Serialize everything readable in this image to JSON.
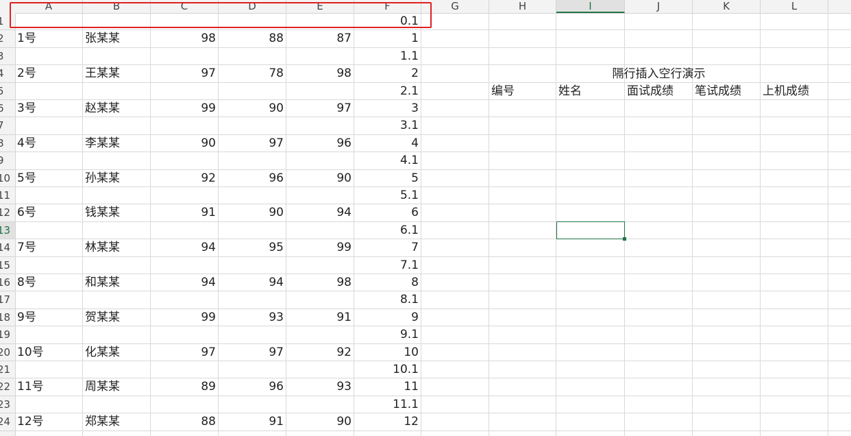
{
  "columns": [
    "A",
    "B",
    "C",
    "D",
    "E",
    "F",
    "G",
    "H",
    "I",
    "J",
    "K",
    "L"
  ],
  "selected_column": "I",
  "selected_row": 13,
  "rows": [
    {
      "num": "1",
      "A": "",
      "B": "",
      "C": "",
      "D": "",
      "E": "",
      "F": "0.1"
    },
    {
      "num": "2",
      "A": "1号",
      "B": "张某某",
      "C": "98",
      "D": "88",
      "E": "87",
      "F": "1"
    },
    {
      "num": "3",
      "A": "",
      "B": "",
      "C": "",
      "D": "",
      "E": "",
      "F": "1.1"
    },
    {
      "num": "4",
      "A": "2号",
      "B": "王某某",
      "C": "97",
      "D": "78",
      "E": "98",
      "F": "2"
    },
    {
      "num": "5",
      "A": "",
      "B": "",
      "C": "",
      "D": "",
      "E": "",
      "F": "2.1"
    },
    {
      "num": "6",
      "A": "3号",
      "B": "赵某某",
      "C": "99",
      "D": "90",
      "E": "97",
      "F": "3"
    },
    {
      "num": "7",
      "A": "",
      "B": "",
      "C": "",
      "D": "",
      "E": "",
      "F": "3.1"
    },
    {
      "num": "8",
      "A": "4号",
      "B": "李某某",
      "C": "90",
      "D": "97",
      "E": "96",
      "F": "4"
    },
    {
      "num": "9",
      "A": "",
      "B": "",
      "C": "",
      "D": "",
      "E": "",
      "F": "4.1"
    },
    {
      "num": "10",
      "A": "5号",
      "B": "孙某某",
      "C": "92",
      "D": "96",
      "E": "90",
      "F": "5"
    },
    {
      "num": "11",
      "A": "",
      "B": "",
      "C": "",
      "D": "",
      "E": "",
      "F": "5.1"
    },
    {
      "num": "12",
      "A": "6号",
      "B": "钱某某",
      "C": "91",
      "D": "90",
      "E": "94",
      "F": "6"
    },
    {
      "num": "13",
      "A": "",
      "B": "",
      "C": "",
      "D": "",
      "E": "",
      "F": "6.1"
    },
    {
      "num": "14",
      "A": "7号",
      "B": "林某某",
      "C": "94",
      "D": "95",
      "E": "99",
      "F": "7"
    },
    {
      "num": "15",
      "A": "",
      "B": "",
      "C": "",
      "D": "",
      "E": "",
      "F": "7.1"
    },
    {
      "num": "16",
      "A": "8号",
      "B": "和某某",
      "C": "94",
      "D": "94",
      "E": "98",
      "F": "8"
    },
    {
      "num": "17",
      "A": "",
      "B": "",
      "C": "",
      "D": "",
      "E": "",
      "F": "8.1"
    },
    {
      "num": "18",
      "A": "9号",
      "B": "贺某某",
      "C": "99",
      "D": "93",
      "E": "91",
      "F": "9"
    },
    {
      "num": "19",
      "A": "",
      "B": "",
      "C": "",
      "D": "",
      "E": "",
      "F": "9.1"
    },
    {
      "num": "20",
      "A": "10号",
      "B": "化某某",
      "C": "97",
      "D": "97",
      "E": "92",
      "F": "10"
    },
    {
      "num": "21",
      "A": "",
      "B": "",
      "C": "",
      "D": "",
      "E": "",
      "F": "10.1"
    },
    {
      "num": "22",
      "A": "11号",
      "B": "周某某",
      "C": "89",
      "D": "96",
      "E": "93",
      "F": "11"
    },
    {
      "num": "23",
      "A": "",
      "B": "",
      "C": "",
      "D": "",
      "E": "",
      "F": "11.1"
    },
    {
      "num": "24",
      "A": "12号",
      "B": "郑某某",
      "C": "88",
      "D": "91",
      "E": "90",
      "F": "12"
    }
  ],
  "demo": {
    "title": "隔行插入空行演示",
    "headers": [
      "编号",
      "姓名",
      "面试成绩",
      "笔试成绩",
      "上机成绩"
    ]
  },
  "colors": {
    "highlight_border": "#e02020",
    "selection": "#217346"
  }
}
